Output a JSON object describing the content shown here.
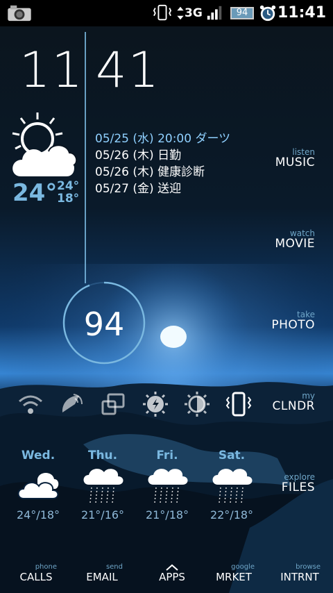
{
  "status_bar": {
    "network": "3G",
    "battery_level": "94",
    "time": "11:41",
    "icons": [
      "camera-icon",
      "vibrate-icon",
      "data-transfer-icon",
      "signal-icon",
      "battery-icon",
      "alarm-icon"
    ]
  },
  "clock": {
    "hour": "11",
    "minute": "41"
  },
  "weather_now": {
    "temp": "24°",
    "high": "24°",
    "low": "18°",
    "condition_icon": "partly-cloudy-icon"
  },
  "calendar": [
    "05/25 (水) 20:00 ダーツ",
    "05/26 (木) 日勤",
    "05/26 (木) 健康診断",
    "05/27 (金) 送迎"
  ],
  "menu": [
    {
      "sub": "listen",
      "label": "MUSIC"
    },
    {
      "sub": "watch",
      "label": "MOVIE"
    },
    {
      "sub": "take",
      "label": "PHOTO"
    },
    {
      "sub": "my",
      "label": "CLNDR"
    },
    {
      "sub": "explore",
      "label": "FILES"
    }
  ],
  "battery_widget": {
    "value": "94",
    "fraction": 0.94
  },
  "toggles": [
    "wifi-icon",
    "gps-icon",
    "auto-rotate-icon",
    "brightness-auto-icon",
    "brightness-icon",
    "vibrate-mode-icon"
  ],
  "forecast": [
    {
      "day": "Wed.",
      "temp": "24°/18°",
      "icon": "cloudy-icon"
    },
    {
      "day": "Thu.",
      "temp": "21°/16°",
      "icon": "rain-icon"
    },
    {
      "day": "Fri.",
      "temp": "21°/18°",
      "icon": "rain-icon"
    },
    {
      "day": "Sat.",
      "temp": "22°/18°",
      "icon": "rain-icon"
    }
  ],
  "dock": [
    {
      "sub": "phone",
      "label": "CALLS"
    },
    {
      "sub": "send",
      "label": "EMAIL"
    },
    {
      "sub": "",
      "label": "APPS"
    },
    {
      "sub": "google",
      "label": "MRKET"
    },
    {
      "sub": "browse",
      "label": "INTRNT"
    }
  ],
  "colors": {
    "accent": "#7ab8e0",
    "background_top": "#0a1420",
    "background_glow": "#1a6fd0"
  }
}
